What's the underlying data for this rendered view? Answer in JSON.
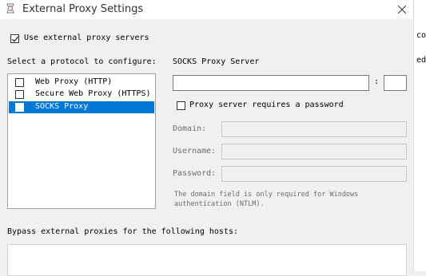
{
  "window": {
    "title": "External Proxy Settings"
  },
  "use_external": {
    "label": "Use external proxy servers",
    "checked": true
  },
  "protocol_section": {
    "label": "Select a protocol to configure:",
    "items": [
      {
        "label": "Web Proxy (HTTP)",
        "checked": false,
        "selected": false
      },
      {
        "label": "Secure Web Proxy (HTTPS)",
        "checked": false,
        "selected": false
      },
      {
        "label": "SOCKS Proxy",
        "checked": false,
        "selected": true
      }
    ]
  },
  "server": {
    "heading": "SOCKS Proxy Server",
    "host_value": "",
    "separator": ":",
    "port_value": "",
    "requires_password_label": "Proxy server requires a password",
    "requires_password_checked": false
  },
  "auth": {
    "domain_label": "Domain:",
    "username_label": "Username:",
    "password_label": "Password:",
    "domain_value": "",
    "username_value": "",
    "password_value": "",
    "note": "The domain field is only required for Windows authentication (NTLM)."
  },
  "bypass": {
    "label": "Bypass external proxies for the following hosts:",
    "value": ""
  },
  "background_window": {
    "fragment_1": "co",
    "fragment_2": "ed"
  },
  "colors": {
    "selection": "#0078d7",
    "dialog_bg": "#f0f0f0"
  },
  "icons": {
    "app": "app-icon",
    "close": "close-icon",
    "check": "checkmark-icon"
  }
}
